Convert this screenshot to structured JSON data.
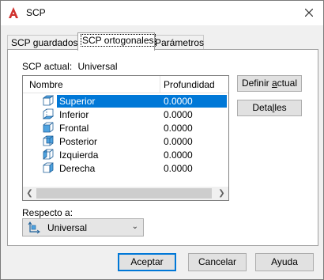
{
  "window": {
    "title": "SCP"
  },
  "tabs": [
    {
      "label": "SCP guardados",
      "active": false
    },
    {
      "label": "SCP ortogonales",
      "active": true
    },
    {
      "label": "Parámetros",
      "active": false
    }
  ],
  "panel": {
    "scp_label": "SCP actual:",
    "scp_value": "Universal",
    "list": {
      "headers": {
        "name": "Nombre",
        "depth": "Profundidad"
      },
      "rows": [
        {
          "name": "Superior",
          "depth": "0.0000",
          "selected": true,
          "icon": "ucs-top-icon"
        },
        {
          "name": "Inferior",
          "depth": "0.0000",
          "selected": false,
          "icon": "ucs-bottom-icon"
        },
        {
          "name": "Frontal",
          "depth": "0.0000",
          "selected": false,
          "icon": "ucs-front-icon"
        },
        {
          "name": "Posterior",
          "depth": "0.0000",
          "selected": false,
          "icon": "ucs-back-icon"
        },
        {
          "name": "Izquierda",
          "depth": "0.0000",
          "selected": false,
          "icon": "ucs-left-icon"
        },
        {
          "name": "Derecha",
          "depth": "0.0000",
          "selected": false,
          "icon": "ucs-right-icon"
        }
      ]
    },
    "buttons": {
      "define_pre": "Definir ",
      "define_u": "a",
      "define_post": "ctual",
      "details_pre": "Deta",
      "details_u": "l",
      "details_post": "les"
    },
    "relative_label": "Respecto a:",
    "relative_value": "Universal"
  },
  "footer": {
    "ok": "Aceptar",
    "cancel": "Cancelar",
    "help": "Ayuda"
  },
  "colors": {
    "selection": "#0078d7",
    "app_icon": "#d0312d",
    "default_border": "#0078d7"
  }
}
